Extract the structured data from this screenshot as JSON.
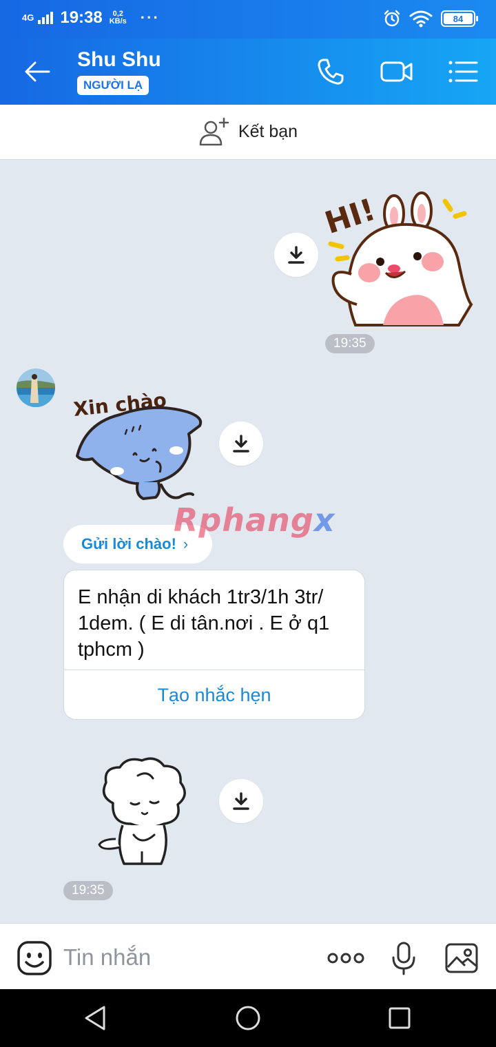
{
  "status_bar": {
    "network": "4G",
    "time": "19:38",
    "speed_value": "0,2",
    "speed_unit": "KB/s",
    "more": "···",
    "battery": "84"
  },
  "header": {
    "contact_name": "Shu Shu",
    "badge": "NGƯỜI LẠ",
    "back_icon": "arrow-left-icon",
    "call_icon": "phone-icon",
    "video_icon": "video-camera-icon",
    "menu_icon": "list-menu-icon",
    "accent_color": "#1a73e8"
  },
  "add_friend": {
    "label": "Kết bạn",
    "icon": "add-user-icon"
  },
  "messages": {
    "sent_sticker_text": "HI!",
    "sent_time": "19:35",
    "received_sticker_text": "Xin chào",
    "greet_chip_label": "Gửi lời chào!",
    "greet_chip_chevron": "›",
    "text_message": "E nhận di khách 1tr3/1h 3tr/ 1dem. ( E di tân.nơi . E ở q1 tphcm )",
    "reminder_action": "Tạo nhắc hẹn",
    "received_time": "19:35"
  },
  "watermark": {
    "part1": "Rphang",
    "part2": "x"
  },
  "input_bar": {
    "placeholder": "Tin nhắn",
    "emoji_icon": "emoji-icon",
    "more_icon": "more-dots-icon",
    "mic_icon": "microphone-icon",
    "image_icon": "image-gallery-icon"
  }
}
